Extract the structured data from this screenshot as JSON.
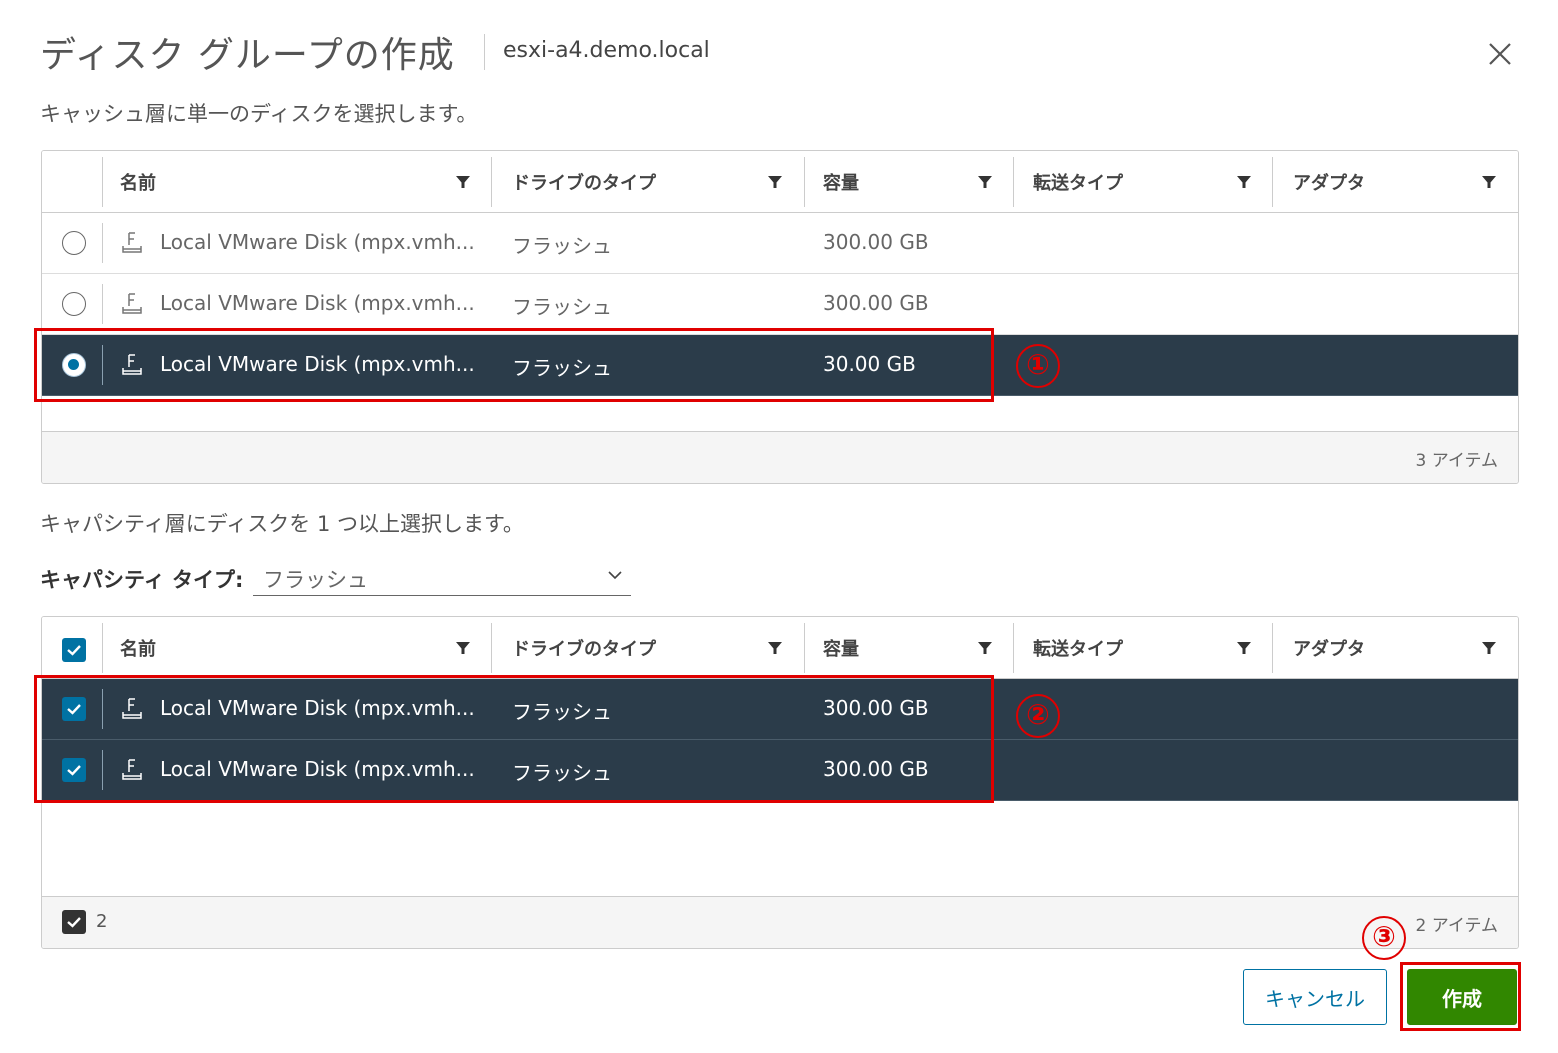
{
  "dialog": {
    "title": "ディスク グループの作成",
    "host": "esxi-a4.demo.local"
  },
  "cache_section": {
    "instruction": "キャッシュ層に単一のディスクを選択します。",
    "columns": [
      "名前",
      "ドライブのタイプ",
      "容量",
      "転送タイプ",
      "アダプタ"
    ],
    "rows": [
      {
        "name": "Local VMware Disk (mpx.vmh...",
        "drive_type": "フラッシュ",
        "capacity": "300.00 GB",
        "selected": false
      },
      {
        "name": "Local VMware Disk (mpx.vmh...",
        "drive_type": "フラッシュ",
        "capacity": "300.00 GB",
        "selected": false
      },
      {
        "name": "Local VMware Disk (mpx.vmh...",
        "drive_type": "フラッシュ",
        "capacity": "30.00 GB",
        "selected": true
      }
    ],
    "item_count": "3 アイテム"
  },
  "capacity_section": {
    "instruction": "キャパシティ層にディスクを 1 つ以上選択します。",
    "type_label": "キャパシティ タイプ:",
    "type_value": "フラッシュ",
    "columns": [
      "名前",
      "ドライブのタイプ",
      "容量",
      "転送タイプ",
      "アダプタ"
    ],
    "rows": [
      {
        "name": "Local VMware Disk (mpx.vmh...",
        "drive_type": "フラッシュ",
        "capacity": "300.00 GB",
        "checked": true
      },
      {
        "name": "Local VMware Disk (mpx.vmh...",
        "drive_type": "フラッシュ",
        "capacity": "300.00 GB",
        "checked": true
      }
    ],
    "selected_count": "2",
    "item_count": "2 アイテム"
  },
  "annotations": [
    "①",
    "②",
    "③"
  ],
  "buttons": {
    "cancel": "キャンセル",
    "create": "作成"
  },
  "colors": {
    "selected_row": "#2b3c4a",
    "accent": "#0072a3",
    "primary_button": "#318700",
    "annotation": "#e00000"
  }
}
